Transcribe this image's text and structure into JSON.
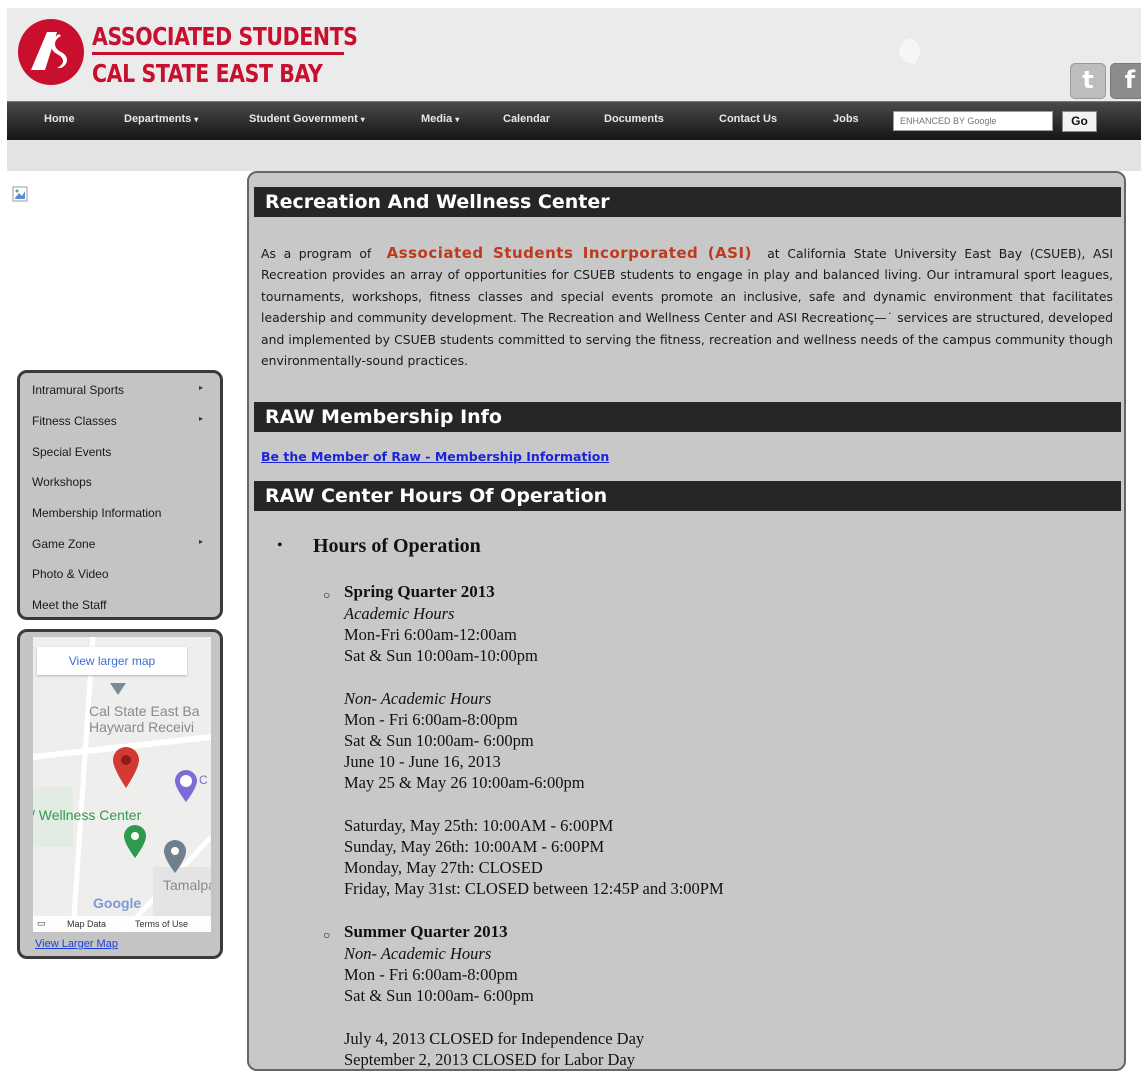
{
  "header": {
    "logo_line1": "ASSOCIATED STUDENTS",
    "logo_line2": "CAL STATE EAST BAY",
    "faded_logo_text": "",
    "twitter_glyph": "t",
    "facebook_glyph": "f"
  },
  "nav": {
    "items": [
      {
        "label": "Home",
        "dropdown": false
      },
      {
        "label": "Departments",
        "dropdown": true
      },
      {
        "label": "Student Government",
        "dropdown": true
      },
      {
        "label": "Media",
        "dropdown": true
      },
      {
        "label": "Calendar",
        "dropdown": false
      },
      {
        "label": "Documents",
        "dropdown": false
      },
      {
        "label": "Contact Us",
        "dropdown": false
      },
      {
        "label": "Jobs",
        "dropdown": false
      }
    ],
    "caret": "▾",
    "search_placeholder": "ENHANCED BY Google",
    "go_label": "Go"
  },
  "side_menu": {
    "items": [
      {
        "label": "Intramural Sports",
        "arrow": true
      },
      {
        "label": "Fitness Classes",
        "arrow": true
      },
      {
        "label": "Special Events",
        "arrow": false
      },
      {
        "label": "Workshops",
        "arrow": false
      },
      {
        "label": "Membership Information",
        "arrow": false
      },
      {
        "label": "Game Zone",
        "arrow": true
      },
      {
        "label": "Photo & Video",
        "arrow": false
      },
      {
        "label": "Meet the Staff",
        "arrow": false
      }
    ],
    "arrow_glyph": "▸"
  },
  "map": {
    "view_larger_button": "View larger map",
    "label_csueb": "Cal State East Ba",
    "label_hayward": "Hayward Receivi",
    "label_wellness": "/ Wellness Center",
    "label_tamalpa": "Tamalpa",
    "label_c": "C",
    "google_logo": "Google",
    "footer_map_data": "Map Data",
    "footer_terms": "Terms of Use",
    "view_larger_link": "View Larger Map"
  },
  "content": {
    "section1_title": "Recreation And Wellness Center",
    "intro_before": "As a program of",
    "asi_name": "Associated Students Incorporated (ASI)",
    "intro_after": "at California State University East Bay (CSUEB), ASI Recreation provides an array of opportunities for CSUEB students to engage in play and balanced living. Our intramural sport leagues, tournaments, workshops, fitness classes and special events promote an inclusive, safe and dynamic environment that facilitates leadership and community development. The Recreation and Wellness Center and ASI Recreationç—˙ services are structured, developed and implemented by CSUEB students committed to serving the fitness, recreation and wellness needs of the campus community though environmentally-sound practices.",
    "section2_title": "RAW Membership Info",
    "membership_link": "Be the Member of Raw - Membership Information",
    "section3_title": "RAW Center Hours Of Operation",
    "hours_bullet": "•",
    "hours_title": "Hours of Operation",
    "sub_bullet": "○",
    "spring": {
      "title": "Spring Quarter 2013",
      "academic_label": "Academic Hours",
      "academic_lines": [
        "Mon-Fri 6:00am-12:00am",
        "Sat & Sun 10:00am-10:00pm"
      ],
      "non_academic_label": "Non- Academic Hours",
      "non_academic_lines": [
        "Mon - Fri 6:00am-8:00pm",
        "Sat & Sun 10:00am- 6:00pm",
        "June 10 - June 16, 2013",
        "May 25 & May 26 10:00am-6:00pm"
      ],
      "special_lines": [
        "Saturday, May 25th: 10:00AM - 6:00PM",
        "Sunday, May 26th: 10:00AM - 6:00PM",
        "Monday, May 27th: CLOSED",
        "Friday, May 31st: CLOSED between 12:45P and 3:00PM"
      ]
    },
    "summer": {
      "title": "Summer Quarter 2013",
      "non_academic_label": "Non- Academic Hours",
      "non_academic_lines": [
        "Mon - Fri 6:00am-8:00pm",
        "Sat & Sun 10:00am- 6:00pm"
      ],
      "closed_lines": [
        "July 4, 2013 CLOSED for Independence Day",
        "September 2, 2013 CLOSED for Labor Day"
      ]
    }
  },
  "colors": {
    "brand_red": "#c8102e",
    "asi_orange": "#c1391c",
    "nav_dark": "#1a1a1a",
    "panel_gray": "#c8c8c8",
    "link_blue": "#1a25d8"
  }
}
